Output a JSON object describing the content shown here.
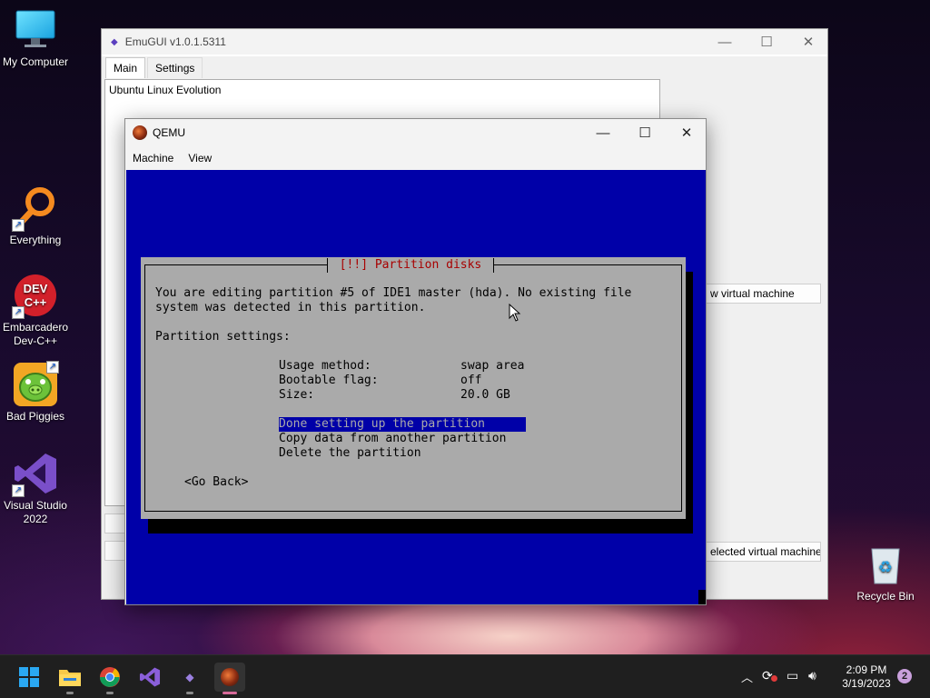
{
  "desktop": {
    "icons": [
      {
        "label": "My Computer",
        "icon": "monitor-icon"
      },
      {
        "label": "Everything",
        "icon": "magnifier-icon"
      },
      {
        "label": "Embarcadero Dev-C++",
        "icon": "devcpp-icon",
        "badge": "DEV C++"
      },
      {
        "label": "Bad Piggies",
        "icon": "pig-icon"
      },
      {
        "label": "Visual Studio 2022",
        "icon": "visual-studio-icon"
      },
      {
        "label": "Recycle Bin",
        "icon": "recycle-bin-icon"
      }
    ]
  },
  "emugui": {
    "title": "EmuGUI v1.0.1.5311",
    "tabs": [
      "Main",
      "Settings"
    ],
    "vm_list": [
      "Ubuntu Linux Evolution"
    ],
    "buttons": {
      "new_vm": "w virtual machine",
      "delete_vm": "elected virtual machine"
    }
  },
  "qemu": {
    "title": "QEMU",
    "menus": [
      "Machine",
      "View"
    ],
    "installer": {
      "dialog_title": "[!!] Partition disks",
      "message_line1": "You are editing partition #5 of IDE1 master (hda). No existing file",
      "message_line2": "system was detected in this partition.",
      "settings_header": "Partition settings:",
      "settings": [
        {
          "label": "Usage method:",
          "value": "swap area"
        },
        {
          "label": "Bootable flag:",
          "value": "off"
        },
        {
          "label": "Size:",
          "value": "20.0 GB"
        }
      ],
      "options": [
        "Done setting up the partition",
        "Copy data from another partition",
        "Delete the partition"
      ],
      "go_back": "<Go Back>"
    }
  },
  "taskbar": {
    "apps": [
      "start-icon",
      "file-explorer-icon",
      "chrome-icon",
      "visual-studio-icon",
      "emugui-icon",
      "qemu-icon"
    ],
    "time": "2:09 PM",
    "date": "3/19/2023",
    "notification_count": "2"
  },
  "colors": {
    "qemu_background": "#0000a8",
    "dialog_grey": "#aaaaaa",
    "dialog_title_red": "#a80000"
  }
}
